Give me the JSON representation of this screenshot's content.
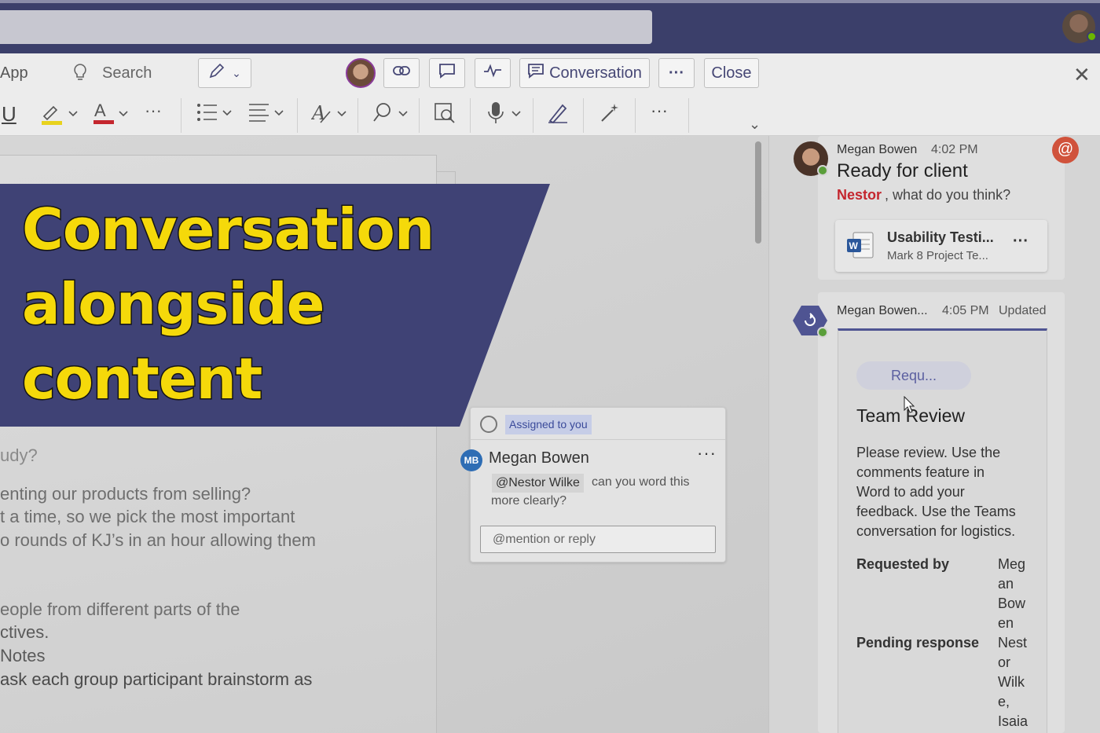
{
  "ribbon": {
    "app_label": "App",
    "search_label": "Search",
    "conversation_label": "Conversation",
    "more_label": "···",
    "close_label": "Close",
    "underline": "U",
    "more_tools": "···"
  },
  "document": {
    "lines": [
      "udy?",
      "enting our products from selling?",
      "t a time, so we pick the most important",
      "o rounds of KJ’s in an hour allowing them",
      "eople from different parts of the",
      "ctives.",
      "Notes",
      "ask each group participant brainstorm as"
    ]
  },
  "banner": {
    "lines": [
      "Conversation",
      "alongside",
      "content"
    ]
  },
  "comment": {
    "assigned": "Assigned to you",
    "initials": "MB",
    "author": "Megan Bowen",
    "mention": "@Nestor Wilke",
    "body_line1": "can you word this",
    "body_line2": "more clearly?",
    "reply_placeholder": "@mention or reply"
  },
  "panel": {
    "msg1": {
      "author": "Megan Bowen",
      "time": "4:02 PM",
      "title": "Ready for client",
      "mention_name": "Nestor",
      "text_rest": ", what do you think?",
      "file_name": "Usability Testi...",
      "file_sub": "Mark 8 Project Te...",
      "at": "@"
    },
    "msg2": {
      "author": "Megan Bowen...",
      "time": "4:05 PM",
      "status": "Updated",
      "pill": "Requ...",
      "card_title": "Team Review",
      "para": [
        "Please review. Use the",
        "comments feature in",
        "Word to add your",
        "feedback. Use the Teams",
        "conversation for logistics."
      ],
      "requested_by_label": "Requested by",
      "requested_by_value": [
        "Meg",
        "an",
        "Bow",
        "en"
      ],
      "pending_label": "Pending response",
      "pending_value": [
        "Nest",
        "or",
        "Wilk",
        "e,",
        "Isaia"
      ]
    }
  },
  "colors": {
    "titlebar": "#3b3f6a",
    "banner_bg": "#3f4275",
    "banner_text": "#f5d90a",
    "mention_red": "#c4262e",
    "accent": "#464775"
  }
}
